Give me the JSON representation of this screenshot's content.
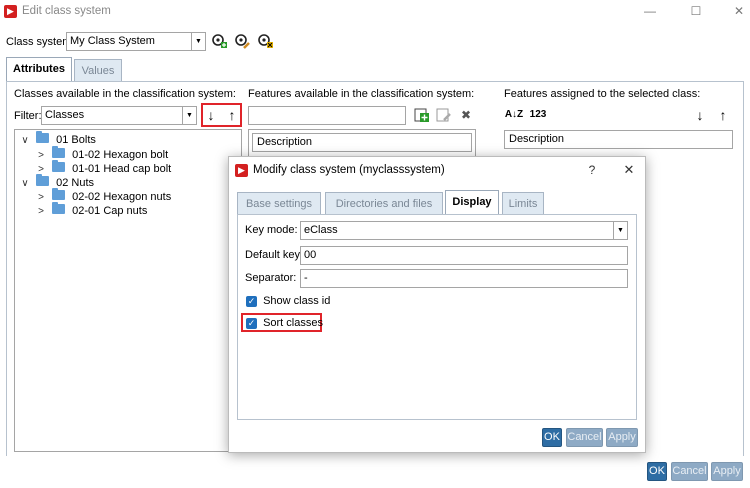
{
  "window": {
    "title": "Edit class system",
    "minimize": "—",
    "maximize": "☐",
    "close": "✕"
  },
  "class_system": {
    "label": "Class system:",
    "value": "My Class System"
  },
  "tabs": [
    {
      "label": "Attributes",
      "active": true
    },
    {
      "label": "Values",
      "active": false
    }
  ],
  "classes_panel": {
    "heading": "Classes available in the classification system:",
    "filter_label": "Filter:",
    "filter_value": "Classes",
    "sort_down": "↓",
    "sort_up": "↑",
    "tree": [
      {
        "level": 0,
        "label": "01 Bolts",
        "caret": "∨"
      },
      {
        "level": 1,
        "label": "01-02 Hexagon bolt",
        "caret": ">"
      },
      {
        "level": 1,
        "label": "01-01 Head cap bolt",
        "caret": ">"
      },
      {
        "level": 0,
        "label": "02 Nuts",
        "caret": "∨"
      },
      {
        "level": 1,
        "label": "02-02 Hexagon nuts",
        "caret": ">"
      },
      {
        "level": 1,
        "label": "02-01 Cap nuts",
        "caret": ">"
      }
    ]
  },
  "features_panel": {
    "heading": "Features available in the classification system:",
    "column": "Description"
  },
  "assigned_panel": {
    "heading": "Features assigned to the selected class:",
    "sort_az": "A↓Z",
    "sort_num": "123",
    "down": "↓",
    "up": "↑",
    "column": "Description"
  },
  "main_buttons": {
    "ok": "OK",
    "cancel": "Cancel",
    "apply": "Apply"
  },
  "modal": {
    "title": "Modify class system (myclasssystem)",
    "help": "?",
    "close": "✕",
    "tabs": [
      {
        "label": "Base settings",
        "active": false
      },
      {
        "label": "Directories and files",
        "active": false
      },
      {
        "label": "Display",
        "active": true
      },
      {
        "label": "Limits",
        "active": false
      }
    ],
    "key_mode_label": "Key mode:",
    "key_mode_value": "eClass",
    "default_key_label": "Default key:",
    "default_key_value": "00",
    "separator_label": "Separator:",
    "separator_value": "-",
    "show_class_id_label": "Show class id",
    "show_class_id_checked": true,
    "sort_classes_label": "Sort classes",
    "sort_classes_checked": true,
    "buttons": {
      "ok": "OK",
      "cancel": "Cancel",
      "apply": "Apply"
    }
  },
  "colors": {
    "accent": "#2e6da4",
    "highlight": "#e0242a",
    "folder": "#5f9ed8",
    "tab_inactive": "#dfe9f2"
  }
}
